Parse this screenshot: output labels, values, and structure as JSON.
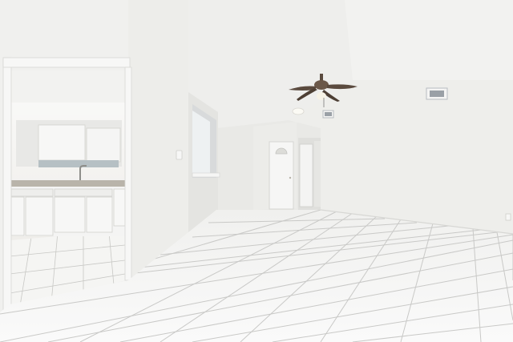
{
  "scene": {
    "kind": "photo",
    "subject": "empty-room-interior",
    "colors": {
      "wall": "#eeeeec",
      "wall_shadow": "#e2e2df",
      "ceiling": "#f3f3f1",
      "floor_tile": "#f7f7f6",
      "grout": "#c9c9c7",
      "door": "#f6f6f5",
      "fan_blade": "#5a4a3e",
      "vent": "#9aa0a6",
      "counter": "#b9b4aa",
      "cabinet": "#f4f4f3"
    }
  }
}
